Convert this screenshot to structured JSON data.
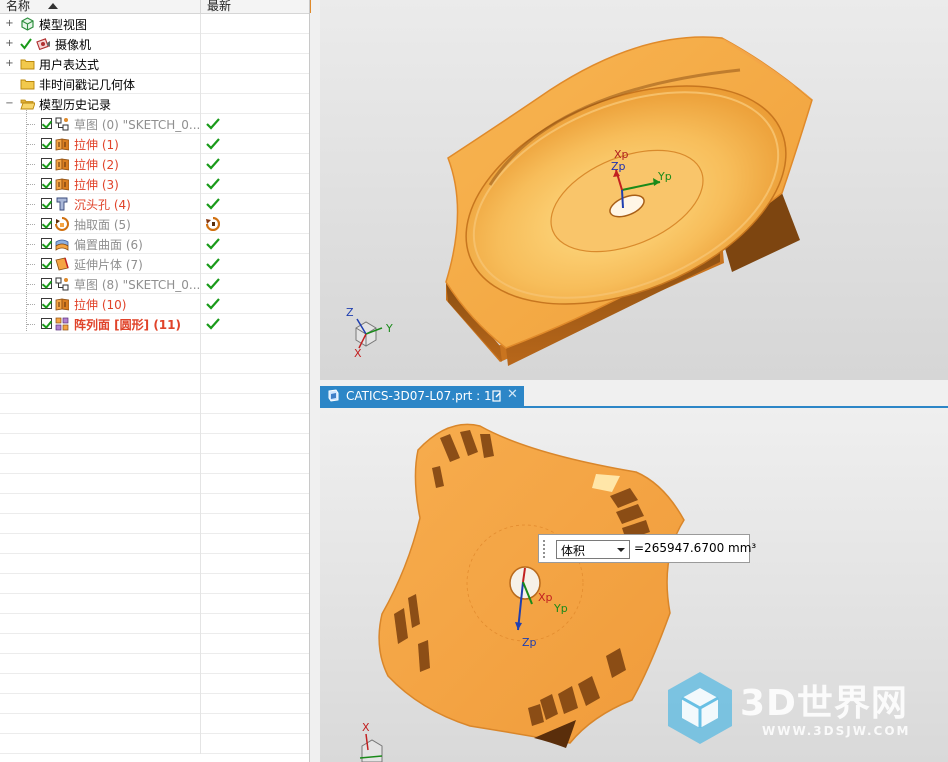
{
  "navigator": {
    "columns": {
      "name": "名称",
      "latest": "最新"
    },
    "nodes": [
      {
        "label": "模型视图",
        "icon": "model-views-icon",
        "style": "normal"
      },
      {
        "label": "摄像机",
        "icon": "camera-icon",
        "style": "normal"
      },
      {
        "label": "用户表达式",
        "icon": "folder-icon",
        "style": "normal"
      },
      {
        "label": "非时间戳记几何体",
        "icon": "folder-icon",
        "style": "normal"
      },
      {
        "label": "模型历史记录",
        "icon": "folder-open-icon",
        "style": "normal"
      }
    ],
    "features": [
      {
        "label": "草图 (0) \"SKETCH_0...",
        "icon": "sketch-icon",
        "style": "gray",
        "status": "check"
      },
      {
        "label": "拉伸 (1)",
        "icon": "extrude-icon",
        "style": "red",
        "status": "check"
      },
      {
        "label": "拉伸 (2)",
        "icon": "extrude-icon",
        "style": "red",
        "status": "check"
      },
      {
        "label": "拉伸 (3)",
        "icon": "extrude-icon",
        "style": "red",
        "status": "check"
      },
      {
        "label": "沉头孔 (4)",
        "icon": "counterbore-hole-icon",
        "style": "red",
        "status": "check"
      },
      {
        "label": "抽取面 (5)",
        "icon": "extract-face-icon",
        "style": "gray",
        "status": "update"
      },
      {
        "label": "偏置曲面 (6)",
        "icon": "offset-surface-icon",
        "style": "gray",
        "status": "check"
      },
      {
        "label": "延伸片体 (7)",
        "icon": "extend-sheet-icon",
        "style": "gray",
        "status": "check"
      },
      {
        "label": "草图 (8) \"SKETCH_0...",
        "icon": "sketch-icon",
        "style": "gray",
        "status": "check"
      },
      {
        "label": "拉伸 (10)",
        "icon": "extrude-icon",
        "style": "red",
        "status": "check"
      },
      {
        "label": "阵列面 [圆形] (11)",
        "icon": "pattern-face-icon",
        "style": "redb",
        "status": "check"
      }
    ]
  },
  "tab": {
    "title": "CATICS-3D07-L07.prt : 1",
    "close": "✕"
  },
  "top_view": {
    "csys": {
      "x": "Xp",
      "y": "Yp",
      "z": "Zp"
    },
    "triad": {
      "x": "X",
      "y": "Y",
      "z": "Z"
    }
  },
  "bottom_view": {
    "csys": {
      "x": "Xp",
      "y": "Yp",
      "z": "Zp"
    },
    "triad": {
      "x": "X"
    }
  },
  "measure": {
    "type": "体积",
    "result": "=265947.6700 mm³"
  },
  "watermark": {
    "title": "3D世界网",
    "url": "WWW.3DSJW.COM"
  },
  "colors": {
    "part": "#f5a443",
    "accent": "#2c86c7",
    "feature_red": "#e0432a"
  }
}
